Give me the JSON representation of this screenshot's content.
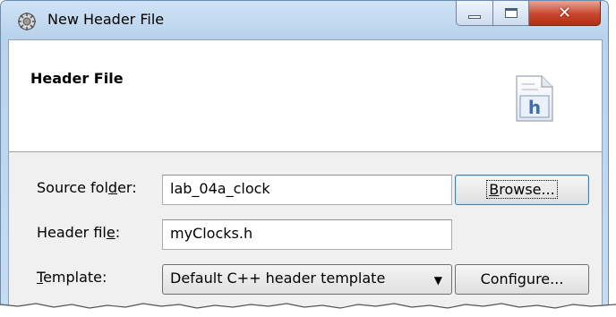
{
  "window": {
    "title": "New Header File",
    "app_icon": "gear-cube-icon",
    "controls": {
      "minimize": "minimize-icon",
      "maximize": "maximize-icon",
      "close": "close-icon"
    }
  },
  "banner": {
    "title": "Header File",
    "icon": "h-file-icon",
    "icon_glyph": "h"
  },
  "form": {
    "source_folder": {
      "label_pre": "Source fol",
      "label_accel": "d",
      "label_post": "er:",
      "value": "lab_04a_clock"
    },
    "header_file": {
      "label_pre": "Header fil",
      "label_accel": "e",
      "label_post": ":",
      "value": "myClocks.h"
    },
    "template": {
      "label_pre": "",
      "label_accel": "T",
      "label_post": "emplate:",
      "value": "Default C++ header template"
    }
  },
  "buttons": {
    "browse": {
      "accel": "B",
      "rest": "rowse..."
    },
    "configure": "Configure..."
  }
}
